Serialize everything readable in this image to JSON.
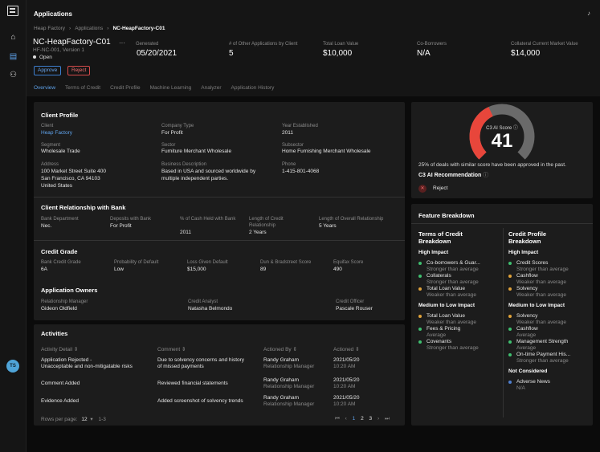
{
  "app": {
    "title": "Applications"
  },
  "breadcrumb": [
    "Heap Factory",
    "Applications",
    "NC-HeapFactory-C01"
  ],
  "record": {
    "title": "NC-HeapFactory-C01",
    "sub": "HF-NC-001, Version 1",
    "status": "Open",
    "approve_label": "Approve",
    "reject_label": "Reject",
    "stats": [
      {
        "label": "Generated",
        "value": "05/20/2021"
      },
      {
        "label": "# of Other Applications by Client",
        "value": "5"
      },
      {
        "label": "Total Loan Value",
        "value": "$10,000"
      },
      {
        "label": "Co-Borrowers",
        "value": "N/A"
      },
      {
        "label": "Collateral Current Market Value",
        "value": "$14,000"
      }
    ]
  },
  "tabs": [
    "Overview",
    "Terms of Credit",
    "Credit Profile",
    "Machine Learning",
    "Analyzer",
    "Application History"
  ],
  "client_profile": {
    "title": "Client Profile",
    "client_label": "Client",
    "client_value": "Heap Factory",
    "company_type_label": "Company Type",
    "company_type_value": "For Profit",
    "year_label": "Year Established",
    "year_value": "2011",
    "segment_label": "Segment",
    "segment_value": "Wholesale Trade",
    "sector_label": "Sector",
    "sector_value": "Furniture Merchant Wholesale",
    "subsector_label": "Subsector",
    "subsector_value": "Home Furnishing Merchant Wholesale",
    "address_label": "Address",
    "address_lines": [
      "100 Market Street Suite 400",
      "San Francisco, CA 94103",
      "United States"
    ],
    "desc_label": "Business Description",
    "desc_lines": [
      "Based in USA and sourced worldwide by",
      "multiple independent parties."
    ],
    "phone_label": "Phone",
    "phone_value": "1-415-801-4068"
  },
  "relationship": {
    "title": "Client Relationship with Bank",
    "items": [
      {
        "label": "Bank Department",
        "value": "Nec."
      },
      {
        "label": "Deposits with Bank",
        "value": "For Profit"
      },
      {
        "label": "% of Cash Held with Bank",
        "value": "2011"
      },
      {
        "label": "Length of Credit Relationship",
        "value": "2 Years"
      },
      {
        "label": "Length of Overall Relationship",
        "value": "5 Years"
      }
    ]
  },
  "credit_grade": {
    "title": "Credit Grade",
    "items": [
      {
        "label": "Bank Credit Grade",
        "value": "6A"
      },
      {
        "label": "Probability of Default",
        "value": "Low"
      },
      {
        "label": "Loss Given Default",
        "value": "$15,000"
      },
      {
        "label": "Dun & Bradstreet Score",
        "value": "89"
      },
      {
        "label": "Equifax Score",
        "value": "490"
      }
    ]
  },
  "owners": {
    "title": "Application Owners",
    "items": [
      {
        "label": "Relationship Manager",
        "value": "Gideon Oldfield"
      },
      {
        "label": "Credit Analyst",
        "value": "Natasha Belmondo"
      },
      {
        "label": "Credit Officer",
        "value": "Pascale Rouser"
      }
    ]
  },
  "activities": {
    "title": "Activities",
    "headers": [
      "Activity Detail ⇕",
      "Comment ⇕",
      "Actioned By ⇕",
      "Actioned ⇕"
    ],
    "rows": [
      {
        "detail": [
          "Application Rejected -",
          "Unacceptable and non-mitigatable risks"
        ],
        "comment": [
          "Due to solvency concerns and history",
          "of missed payments"
        ],
        "by": "Randy Graham",
        "role": "Relationship Manager",
        "date": "2021/05/20",
        "time": "10:20 AM"
      },
      {
        "detail": [
          "Comment Added"
        ],
        "comment": [
          "Reviewed financial statements"
        ],
        "by": "Randy Graham",
        "role": "Relationship Manager",
        "date": "2021/05/20",
        "time": "10:20 AM"
      },
      {
        "detail": [
          "Evidence Added"
        ],
        "comment": [
          "Added screenshot of solvency trends"
        ],
        "by": "Randy Graham",
        "role": "Relationship Manager",
        "date": "2021/05/20",
        "time": "10:20 AM"
      }
    ],
    "rows_per_page_label": "Rows per page:",
    "rows_per_page_value": "12",
    "range": "1-3",
    "pages": [
      "1",
      "2",
      "3"
    ]
  },
  "score": {
    "label": "C3 AI Score",
    "value": "41",
    "fraction": 0.41,
    "note": "25% of deals with similar score have been approved in the past.",
    "rec_title": "C3 AI Recommendation",
    "rec_value": "Reject",
    "colors": {
      "arc": "#e8463b",
      "track": "#6a6a6a"
    }
  },
  "feature": {
    "title": "Feature Breakdown",
    "left_title": [
      "Terms of Credit",
      "Breakdown"
    ],
    "right_title": [
      "Credit Profile",
      "Breakdown"
    ],
    "high": "High Impact",
    "medlow": "Medium to Low Impact",
    "notcons": "Not Considered",
    "left_high": [
      {
        "name": "Co-borrowers & Guar...",
        "desc": "Stronger than average",
        "c": "g"
      },
      {
        "name": "Collaterals",
        "desc": "Stronger than average",
        "c": "g"
      },
      {
        "name": "Total Loan Value",
        "desc": "Weaker than average",
        "c": "o"
      }
    ],
    "left_med": [
      {
        "name": "Total Loan Value",
        "desc": "Weaker than average",
        "c": "o"
      },
      {
        "name": "Fees & Pricing",
        "desc": "Average",
        "c": "g"
      },
      {
        "name": "Covenants",
        "desc": "Stronger than average",
        "c": "g"
      }
    ],
    "right_high": [
      {
        "name": "Credit Scores",
        "desc": "Stronger than average",
        "c": "g"
      },
      {
        "name": "Cashflow",
        "desc": "Weaker than average",
        "c": "o"
      },
      {
        "name": "Solvency",
        "desc": "Weaker than average",
        "c": "o"
      }
    ],
    "right_med": [
      {
        "name": "Solvency",
        "desc": "Weaker than average",
        "c": "o"
      },
      {
        "name": "Cashflow",
        "desc": "Average",
        "c": "g"
      },
      {
        "name": "Management Strength",
        "desc": "Average",
        "c": "g"
      },
      {
        "name": "On-time Payment His...",
        "desc": "Stronger than average",
        "c": "g"
      }
    ],
    "right_not": [
      {
        "name": "Adverse News",
        "desc": "N/A",
        "c": "b"
      }
    ]
  },
  "user": {
    "initials": "TS"
  }
}
